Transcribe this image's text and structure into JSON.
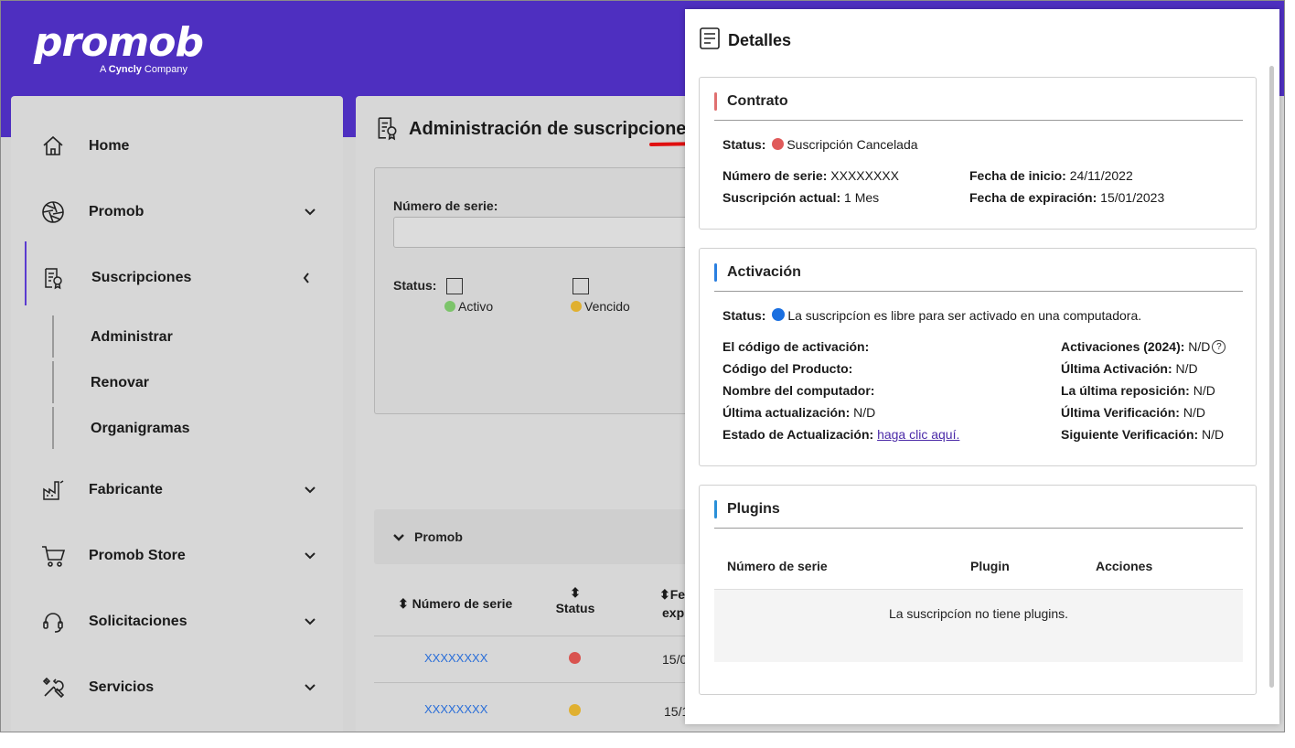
{
  "brand": {
    "logo_text": "promob",
    "tagline_prefix": "A ",
    "tagline_brand": "Cyncly",
    "tagline_suffix": " Company"
  },
  "sidebar": {
    "items": [
      {
        "label": "Home",
        "icon": "home-icon"
      },
      {
        "label": "Promob",
        "icon": "aperture-icon"
      },
      {
        "label": "Suscripciones",
        "icon": "document-badge-icon"
      },
      {
        "label": "Fabricante",
        "icon": "factory-icon"
      },
      {
        "label": "Promob Store",
        "icon": "cart-icon"
      },
      {
        "label": "Solicitaciones",
        "icon": "headset-icon"
      },
      {
        "label": "Servicios",
        "icon": "tools-icon"
      }
    ],
    "subitems": [
      {
        "label": "Administrar"
      },
      {
        "label": "Renovar"
      },
      {
        "label": "Organigramas"
      }
    ]
  },
  "main": {
    "title": "Administración de suscripciones",
    "filter": {
      "serie_label": "Número de serie:",
      "serie_value": "",
      "status_label": "Status:",
      "options": [
        {
          "label": "Activo",
          "color": "#7cc46a"
        },
        {
          "label": "Vencido",
          "color": "#e0b030"
        }
      ]
    },
    "group_label": "Promob",
    "table": {
      "headers": [
        "Número de serie",
        "Status",
        "Fe",
        "exp"
      ],
      "rows": [
        {
          "serie": "XXXXXXXX",
          "status_color": "#d9534f",
          "date": "15/0"
        },
        {
          "serie": "XXXXXXXX",
          "status_color": "#e0b030",
          "date": "15/1"
        }
      ]
    }
  },
  "details": {
    "title": "Detalles",
    "contrato": {
      "title": "Contrato",
      "accent": "#e07070",
      "status_label": "Status:",
      "status_text": "Suscripción Cancelada",
      "status_color": "#e05a5a",
      "serie_label": "Número de serie:",
      "serie_value": "XXXXXXXX",
      "actual_label": "Suscripción actual:",
      "actual_value": "1 Mes",
      "inicio_label": "Fecha de inicio:",
      "inicio_value": "24/11/2022",
      "exp_label": "Fecha de expiración:",
      "exp_value": "15/01/2023"
    },
    "activacion": {
      "title": "Activación",
      "accent": "#2a7fe0",
      "status_label": "Status:",
      "status_text": "La suscripcíon es libre para ser activado en una computadora.",
      "status_color": "#1a6fe0",
      "left": [
        {
          "label": "El código de activación:",
          "value": ""
        },
        {
          "label": "Código del Producto:",
          "value": ""
        },
        {
          "label": "Nombre del computador:",
          "value": ""
        },
        {
          "label": "Última actualización:",
          "value": "N/D"
        },
        {
          "label": "Estado de Actualización:",
          "value": "haga clic aquí."
        }
      ],
      "right": [
        {
          "label": "Activaciones (2024):",
          "value": "N/D"
        },
        {
          "label": "Última Activación:",
          "value": "N/D"
        },
        {
          "label": "La última reposición:",
          "value": "N/D"
        },
        {
          "label": "Última Verificación:",
          "value": "N/D"
        },
        {
          "label": "Siguiente Verificación:",
          "value": "N/D"
        }
      ],
      "help_glyph": "?"
    },
    "plugins": {
      "title": "Plugins",
      "accent": "#2a90d8",
      "headers": [
        "Número de serie",
        "Plugin",
        "Acciones"
      ],
      "empty_text": "La suscripcíon no tiene plugins."
    }
  }
}
